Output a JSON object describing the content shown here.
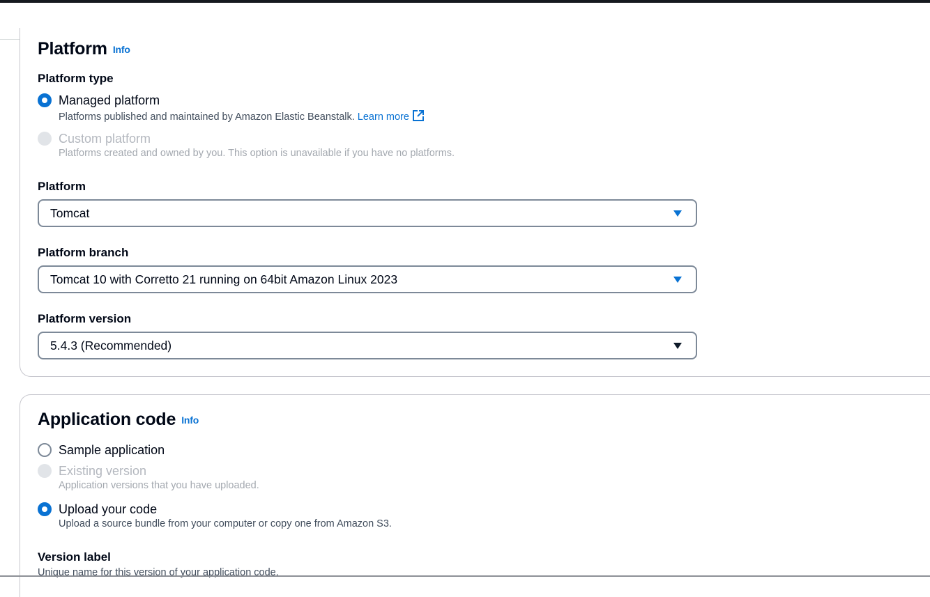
{
  "platform_section": {
    "title": "Platform",
    "info": "Info",
    "platform_type_label": "Platform type",
    "managed": {
      "label": "Managed platform",
      "description": "Platforms published and maintained by Amazon Elastic Beanstalk.",
      "learn_more": "Learn more",
      "selected": true
    },
    "custom": {
      "label": "Custom platform",
      "description": "Platforms created and owned by you. This option is unavailable if you have no platforms.",
      "disabled": true
    },
    "platform_label": "Platform",
    "platform_value": "Tomcat",
    "branch_label": "Platform branch",
    "branch_value": "Tomcat 10 with Corretto 21 running on 64bit Amazon Linux 2023",
    "version_label": "Platform version",
    "version_value": "5.4.3 (Recommended)"
  },
  "app_section": {
    "title": "Application code",
    "info": "Info",
    "sample": {
      "label": "Sample application"
    },
    "existing": {
      "label": "Existing version",
      "description": "Application versions that you have uploaded.",
      "disabled": true
    },
    "upload": {
      "label": "Upload your code",
      "description": "Upload a source bundle from your computer or copy one from Amazon S3.",
      "selected": true
    },
    "version_label": "Version label",
    "version_desc": "Unique name for this version of your application code."
  },
  "colors": {
    "accent": "#0972d3",
    "text": "#000716",
    "disabled": "#b4b8bf"
  }
}
